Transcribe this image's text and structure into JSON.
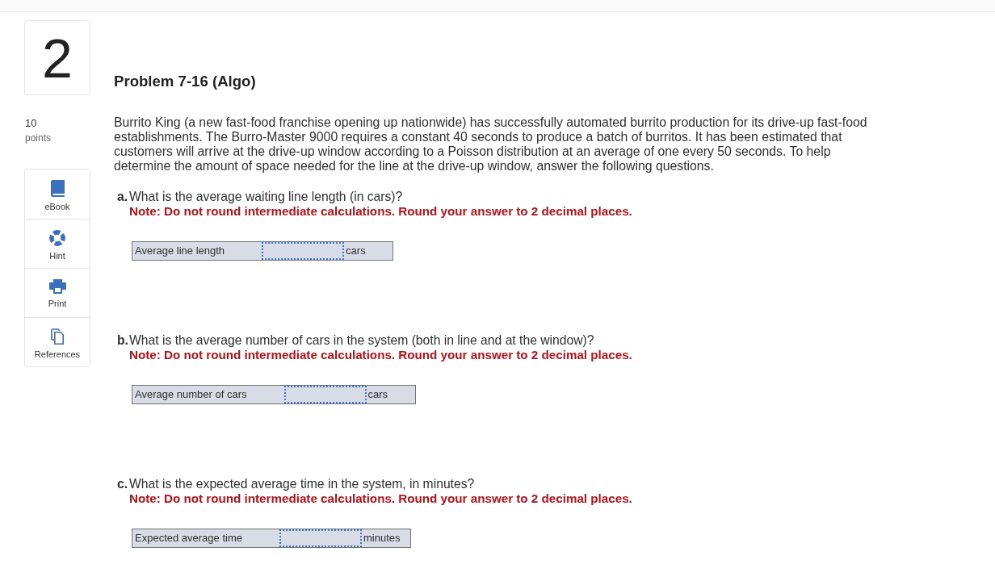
{
  "header": {
    "question_number": "2",
    "title": "Problem 7-16 (Algo)"
  },
  "points": {
    "value": "10",
    "label": "points"
  },
  "tools": [
    {
      "kind": "ebook",
      "label": "eBook"
    },
    {
      "kind": "hint",
      "label": "Hint"
    },
    {
      "kind": "print",
      "label": "Print"
    },
    {
      "kind": "references",
      "label": "References"
    }
  ],
  "statement": "Burrito King (a new fast-food franchise opening up nationwide) has successfully automated burrito production for its drive-up fast-food establishments. The Burro-Master 9000 requires a constant 40 seconds to produce a batch of burritos. It has been estimated that customers will arrive at the drive-up window according to a Poisson distribution at an average of one every 50 seconds. To help determine the amount of space needed for the line at the drive-up window, answer the following questions.",
  "parts": [
    {
      "letter": "a.",
      "question": "What is the average waiting line length (in cars)?",
      "note": "Note: Do not round intermediate calculations. Round your answer to 2 decimal places.",
      "answer": {
        "label": "Average line length",
        "unit": "cars"
      }
    },
    {
      "letter": "b.",
      "question": "What is the average number of cars in the system (both in line and at the window)?",
      "note": "Note: Do not round intermediate calculations. Round your answer to 2 decimal places.",
      "answer": {
        "label": "Average number of cars",
        "unit": "cars"
      }
    },
    {
      "letter": "c.",
      "question": "What is the expected average time in the system, in minutes?",
      "note": "Note: Do not round intermediate calculations. Round your answer to 2 decimal places.",
      "answer": {
        "label": "Expected average time",
        "unit": "minutes"
      }
    }
  ]
}
